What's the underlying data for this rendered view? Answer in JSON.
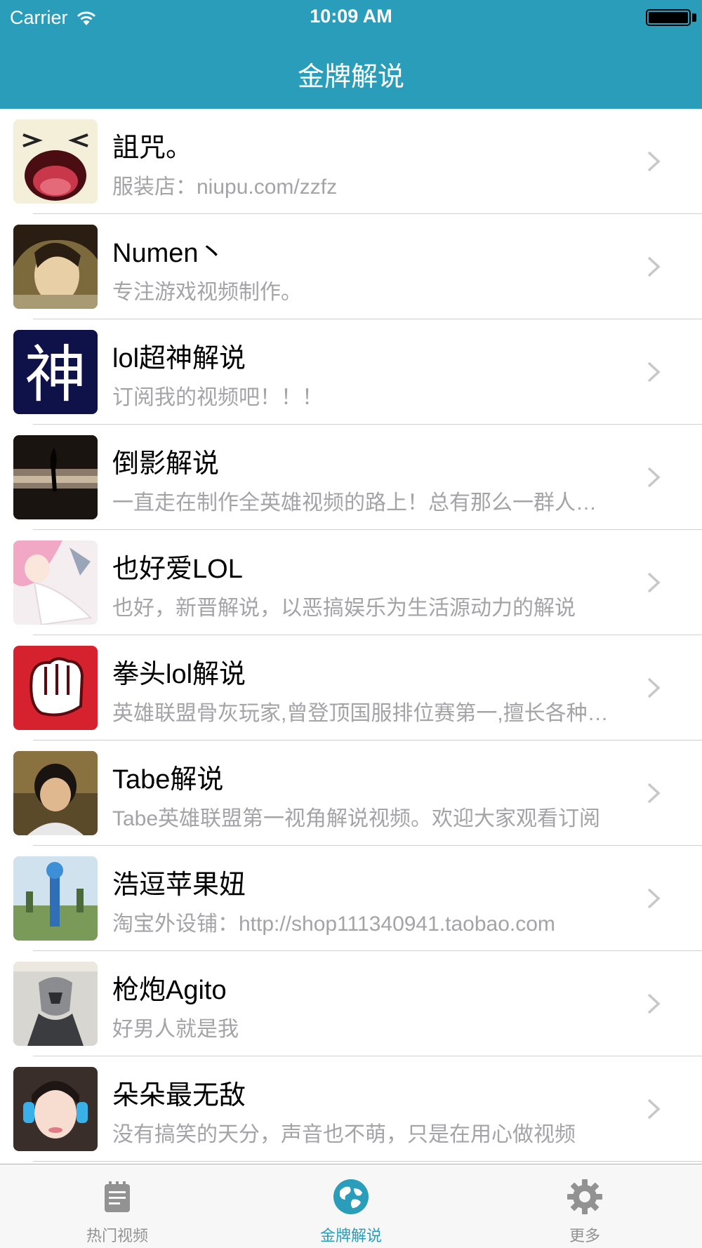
{
  "status_bar": {
    "carrier": "Carrier",
    "time": "10:09 AM"
  },
  "nav": {
    "title": "金牌解说"
  },
  "colors": {
    "accent": "#2a9dba",
    "subtitle": "#a4a4a8",
    "tab_inactive": "#929292"
  },
  "list": {
    "items": [
      {
        "title": "詛咒。",
        "subtitle": "服装店：niupu.com/zzfz",
        "avatar_icon": "laughing-face-avatar"
      },
      {
        "title": "Numen丶",
        "subtitle": "专注游戏视频制作。",
        "avatar_icon": "anime-character-avatar"
      },
      {
        "title": "lol超神解说",
        "subtitle": "订阅我的视频吧！！！",
        "avatar_icon": "shen-character-avatar",
        "avatar_text": "神"
      },
      {
        "title": "倒影解说",
        "subtitle": "一直走在制作全英雄视频的路上！总有那么一群人在默默支持",
        "avatar_icon": "silhouette-sunset-avatar"
      },
      {
        "title": "也好爱LOL",
        "subtitle": "也好，新晋解说，以恶搞娱乐为生活源动力的解说",
        "avatar_icon": "anime-girl-avatar"
      },
      {
        "title": "拳头lol解说",
        "subtitle": "英雄联盟骨灰玩家,曾登顶国服排位赛第一,擅长各种英雄",
        "avatar_icon": "fist-avatar"
      },
      {
        "title": "Tabe解说",
        "subtitle": "Tabe英雄联盟第一视角解说视频。欢迎大家观看订阅",
        "avatar_icon": "person-photo-avatar"
      },
      {
        "title": "浩逗苹果妞",
        "subtitle": "淘宝外设铺：http://shop111340941.taobao.com",
        "avatar_icon": "outdoor-photo-avatar"
      },
      {
        "title": "枪炮Agito",
        "subtitle": "好男人就是我",
        "avatar_icon": "armored-warrior-avatar"
      },
      {
        "title": "朵朵最无敌",
        "subtitle": "没有搞笑的天分，声音也不萌，只是在用心做视频",
        "avatar_icon": "girl-headphones-avatar"
      }
    ]
  },
  "tabbar": {
    "tabs": [
      {
        "label": "热门视频",
        "icon": "clipboard-icon",
        "active": false
      },
      {
        "label": "金牌解说",
        "icon": "globe-icon",
        "active": true
      },
      {
        "label": "更多",
        "icon": "gear-icon",
        "active": false
      }
    ]
  }
}
